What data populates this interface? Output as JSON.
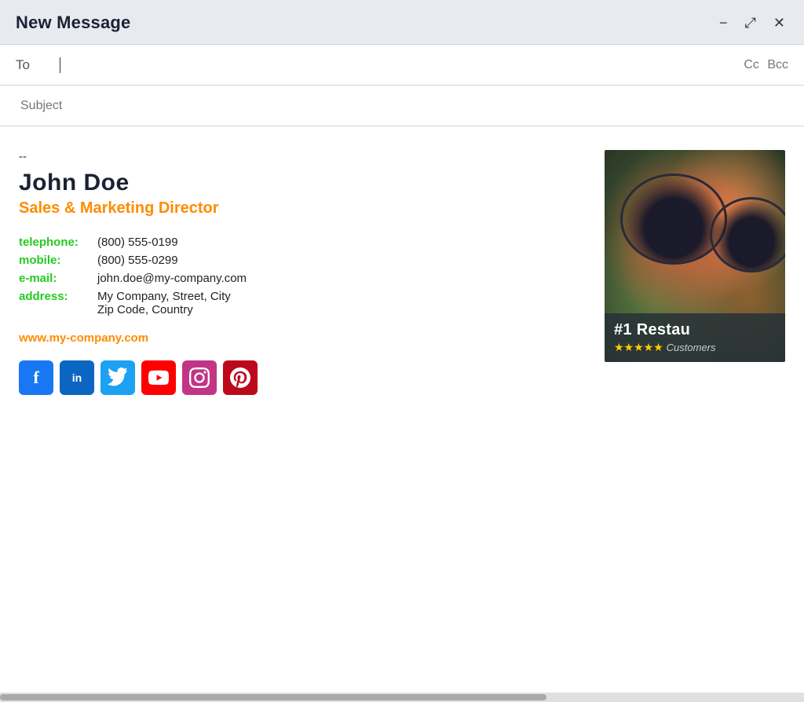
{
  "window": {
    "title": "New Message",
    "minimize_label": "−",
    "maximize_label": "⤢",
    "close_label": "✕"
  },
  "fields": {
    "to_label": "To",
    "to_placeholder": "",
    "cc_label": "Cc",
    "bcc_label": "Bcc",
    "subject_label": "Subject",
    "subject_placeholder": "Subject"
  },
  "signature": {
    "dashes": "--",
    "name": "John Doe",
    "title": "Sales & Marketing Director",
    "contact": {
      "telephone_label": "telephone:",
      "telephone_value": "(800) 555-0199",
      "mobile_label": "mobile:",
      "mobile_value": "(800) 555-0299",
      "email_label": "e-mail:",
      "email_value": "john.doe@my-company.com",
      "address_label": "address:",
      "address_line1": "My Company, Street, City",
      "address_line2": "Zip Code, Country"
    },
    "website": "www.my-company.com",
    "social": {
      "facebook_letter": "f",
      "linkedin_letter": "in",
      "twitter_letter": "🐦",
      "youtube_letter": "▶",
      "instagram_letter": "○",
      "pinterest_letter": "𝕡"
    }
  },
  "image_overlay": {
    "title": "#1 Restau",
    "rating_stars": "★★★★★",
    "subtitle": "Customers"
  },
  "colors": {
    "accent_orange": "#ff8c00",
    "accent_green": "#22cc22",
    "name_dark": "#1a2233",
    "title_bar_bg": "#e8eaf0"
  }
}
